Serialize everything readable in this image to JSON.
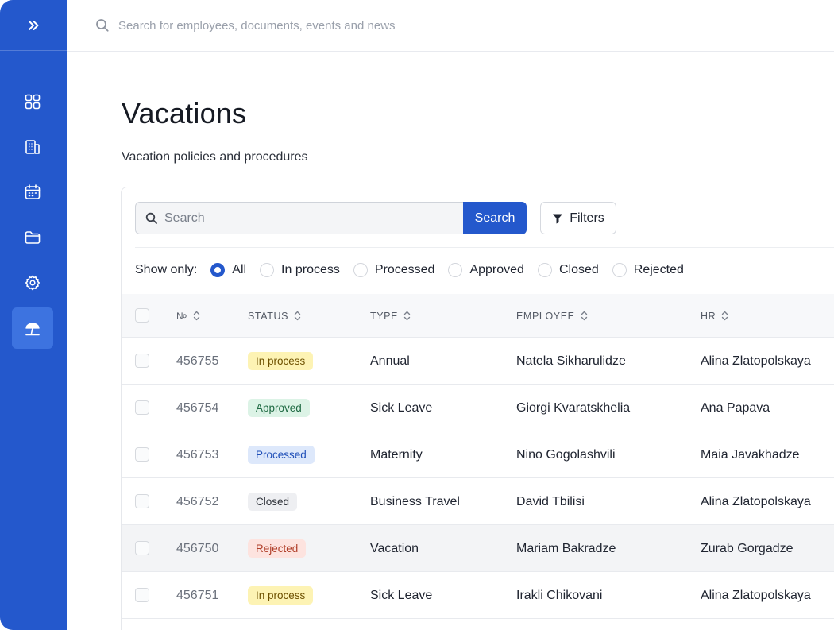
{
  "sidebar": {
    "toggle_icon": "double-chevron-right-icon",
    "items": [
      {
        "name": "dashboard",
        "icon": "grid-icon",
        "active": false
      },
      {
        "name": "company",
        "icon": "building-icon",
        "active": false
      },
      {
        "name": "calendar",
        "icon": "calendar-icon",
        "active": false
      },
      {
        "name": "documents",
        "icon": "folder-icon",
        "active": false
      },
      {
        "name": "settings",
        "icon": "gear-icon",
        "active": false
      },
      {
        "name": "vacations",
        "icon": "beach-umbrella-icon",
        "active": true
      }
    ]
  },
  "topbar": {
    "search_placeholder": "Search for employees, documents, events and news"
  },
  "page": {
    "title": "Vacations",
    "subtitle": "Vacation policies and procedures"
  },
  "toolbar": {
    "search_placeholder": "Search",
    "search_button": "Search",
    "filters_button": "Filters"
  },
  "show_only": {
    "label": "Show only:",
    "options": [
      "All",
      "In process",
      "Processed",
      "Approved",
      "Closed",
      "Rejected"
    ],
    "selected": "All"
  },
  "table": {
    "columns": [
      "№",
      "STATUS",
      "TYPE",
      "EMPLOYEE",
      "HR"
    ],
    "rows": [
      {
        "number": "456755",
        "status": "In process",
        "status_kind": "inprocess",
        "type": "Annual",
        "employee": "Natela Sikharulidze",
        "hr": "Alina Zlatopolskaya"
      },
      {
        "number": "456754",
        "status": "Approved",
        "status_kind": "approved",
        "type": "Sick Leave",
        "employee": "Giorgi Kvaratskhelia",
        "hr": "Ana Papava"
      },
      {
        "number": "456753",
        "status": "Processed",
        "status_kind": "processed",
        "type": "Maternity",
        "employee": "Nino Gogolashvili",
        "hr": "Maia Javakhadze"
      },
      {
        "number": "456752",
        "status": "Closed",
        "status_kind": "closed",
        "type": "Business Travel",
        "employee": "David Tbilisi",
        "hr": "Alina Zlatopolskaya"
      },
      {
        "number": "456750",
        "status": "Rejected",
        "status_kind": "rejected",
        "type": "Vacation",
        "employee": "Mariam Bakradze",
        "hr": "Zurab Gorgadze"
      },
      {
        "number": "456751",
        "status": "In process",
        "status_kind": "inprocess",
        "type": "Sick Leave",
        "employee": "Irakli Chikovani",
        "hr": "Alina Zlatopolskaya"
      }
    ]
  },
  "colors": {
    "brand": "#2458cc",
    "sidebar_active": "#3d73e0"
  }
}
